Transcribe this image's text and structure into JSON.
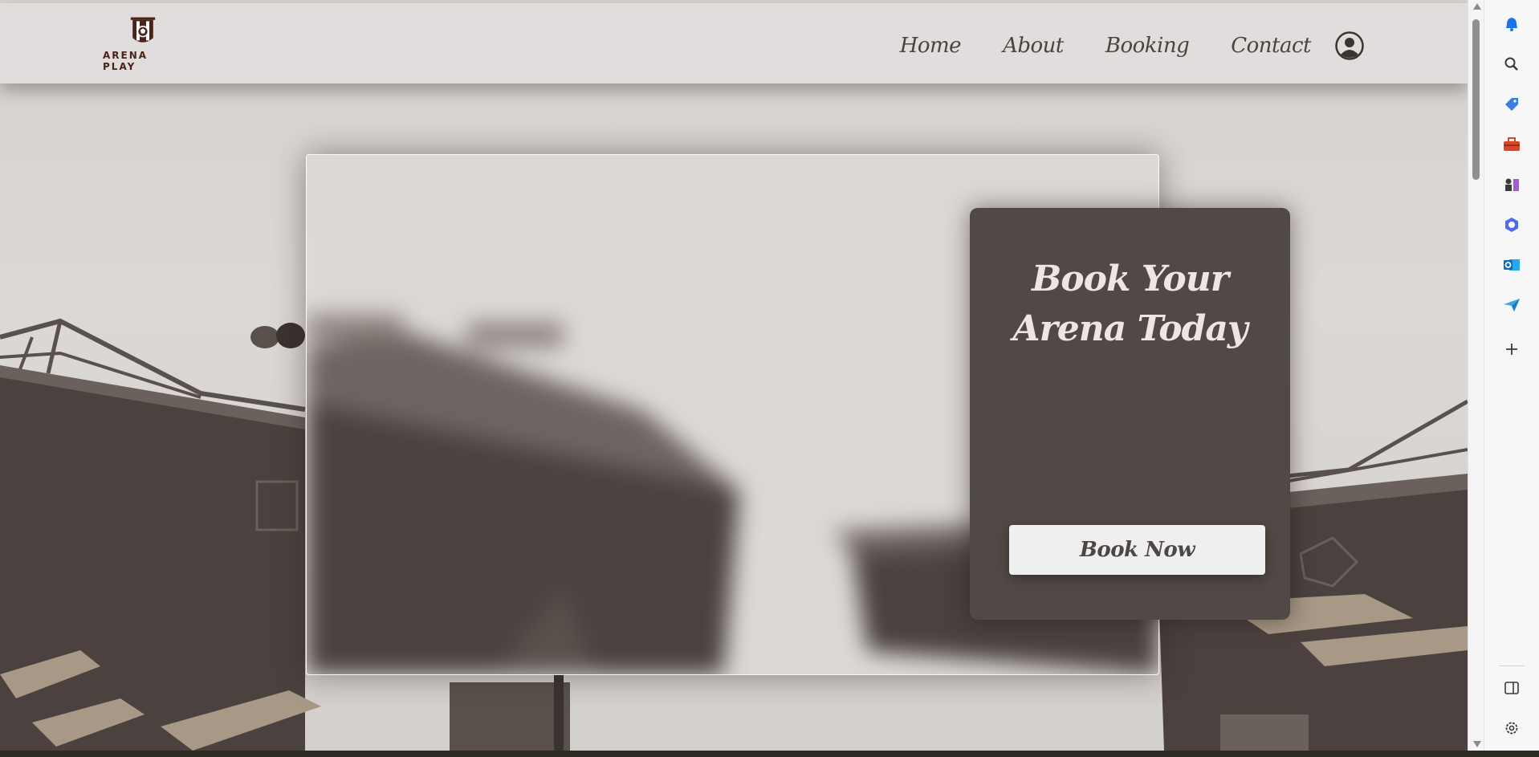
{
  "header": {
    "logo_text": "ARENA PLAY",
    "nav": [
      "Home",
      "About",
      "Booking",
      "Contact"
    ],
    "profile_icon": "user-circle-icon"
  },
  "hero": {
    "title": "Book Your Arena Today",
    "button_label": "Book Now"
  },
  "browser_sidebar": {
    "icons": [
      "bell-icon",
      "search-icon",
      "tag-icon",
      "toolbox-icon",
      "chess-icon",
      "copilot-icon",
      "outlook-icon",
      "send-icon",
      "plus-icon",
      "split-screen-icon",
      "settings-icon"
    ]
  },
  "colors": {
    "card": "#514946",
    "header": "#e1dddc",
    "logo": "#4a2418",
    "nav_text": "#4a4542"
  }
}
